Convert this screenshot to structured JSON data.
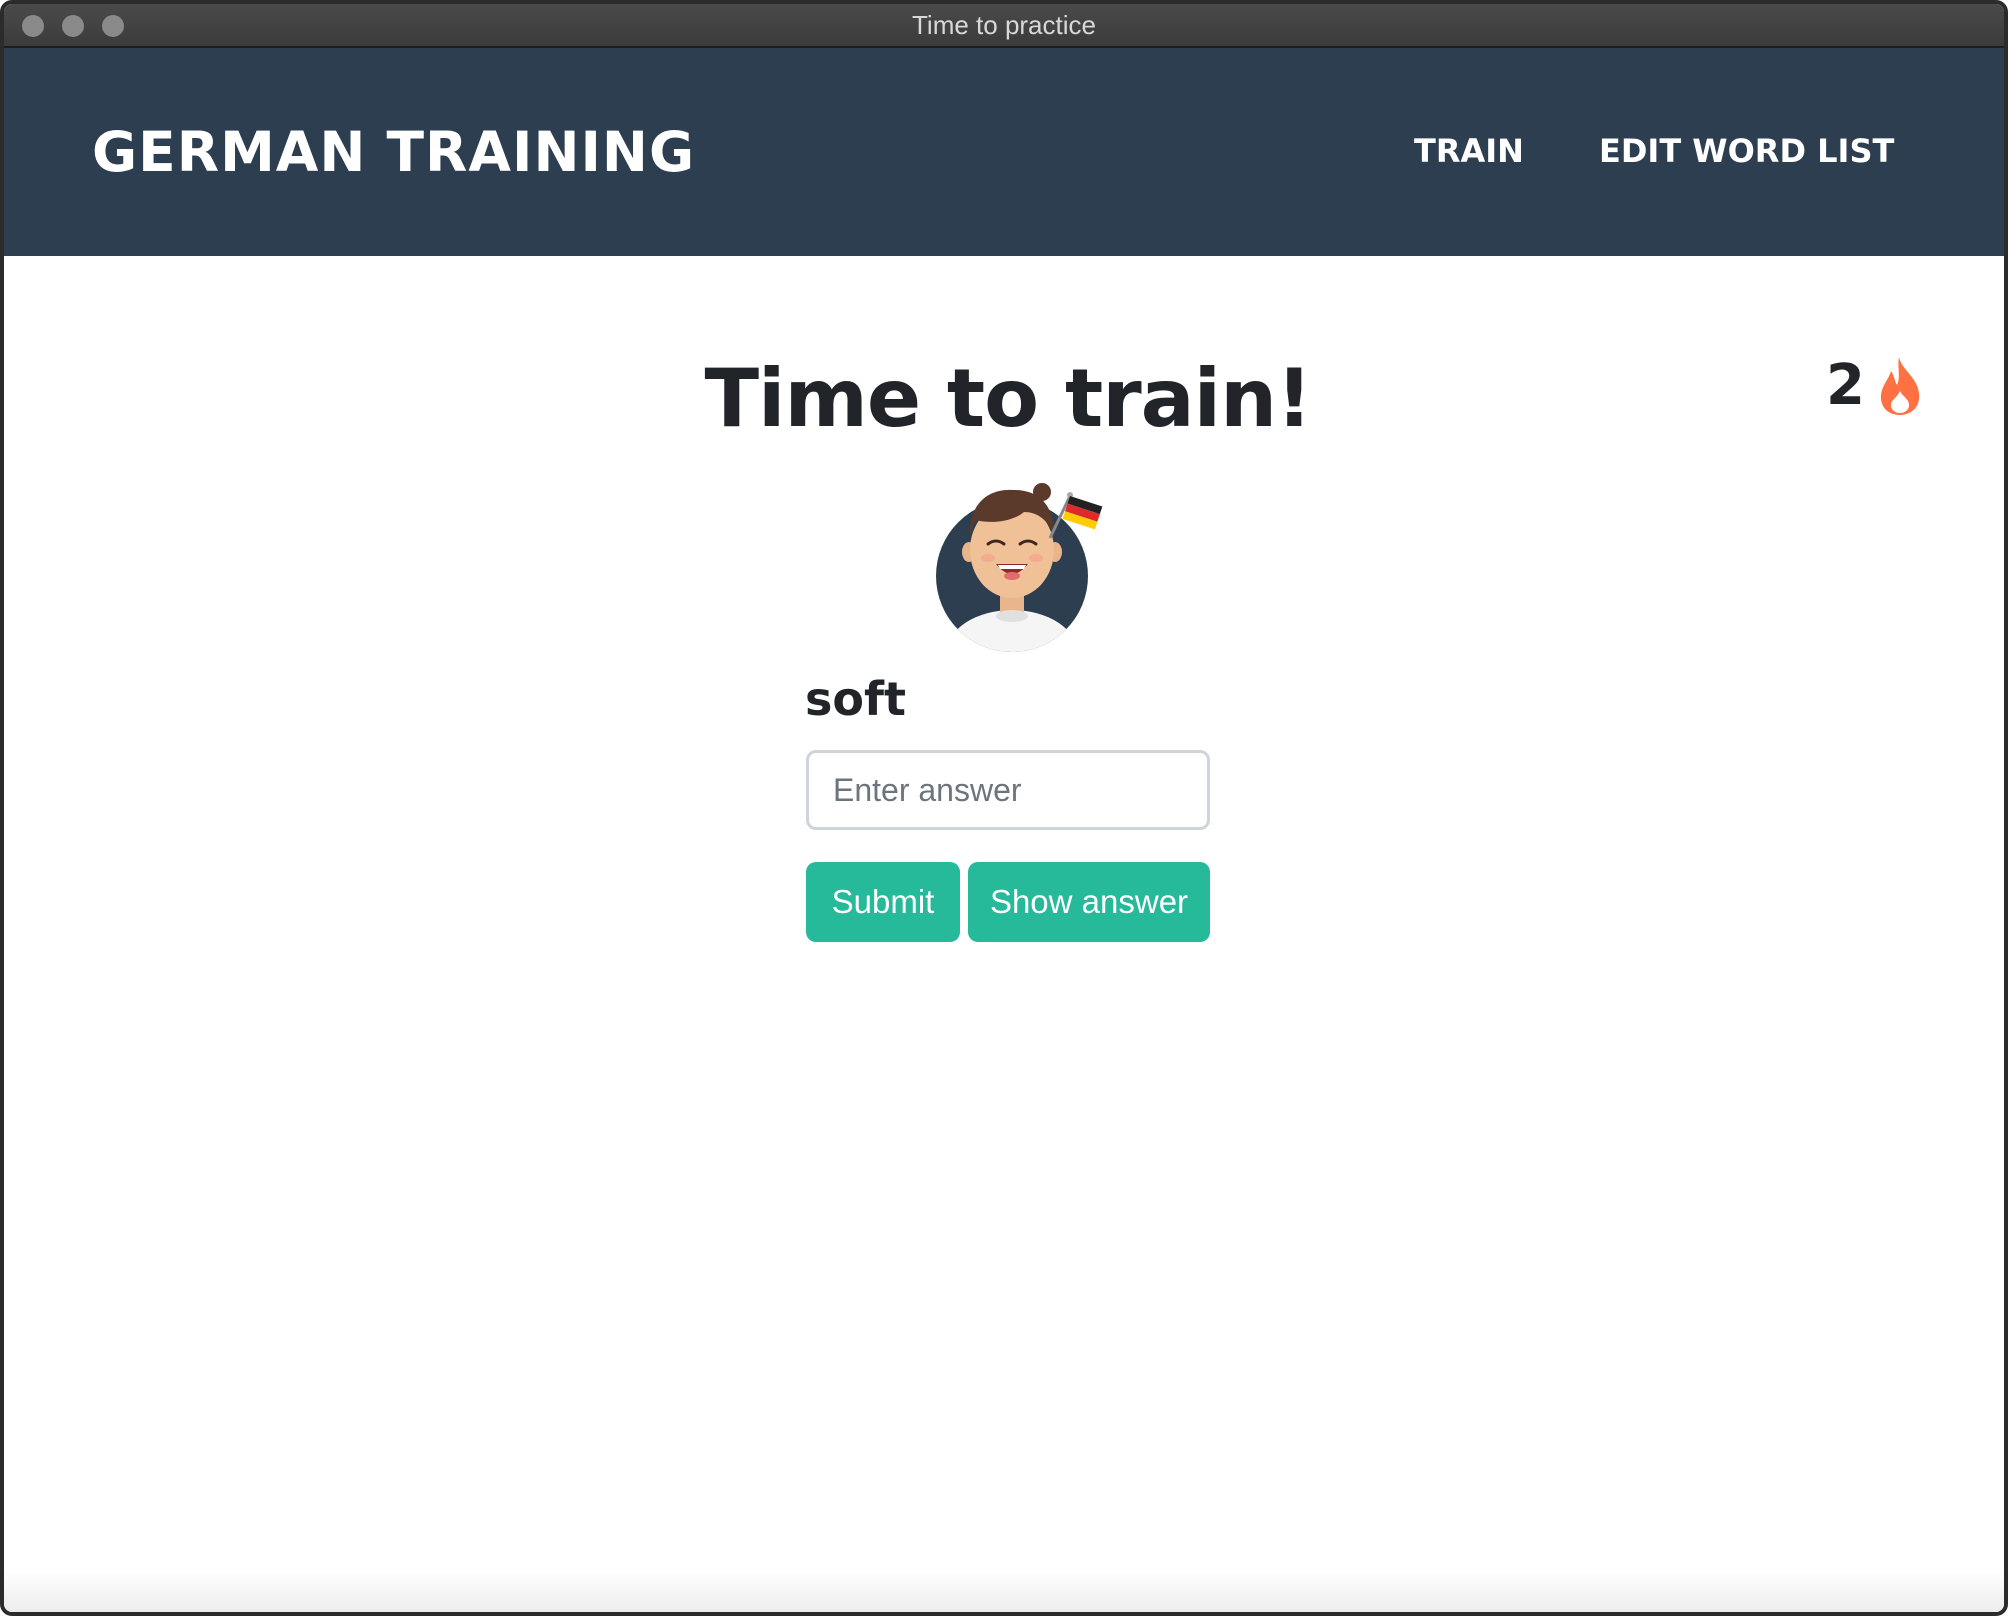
{
  "window": {
    "title": "Time to practice"
  },
  "navbar": {
    "brand": "GERMAN TRAINING",
    "links": [
      {
        "label": "TRAIN"
      },
      {
        "label": "EDIT WORD LIST"
      }
    ],
    "background_color": "#2e3e51"
  },
  "main": {
    "title": "Time to train!",
    "streak": {
      "count": "2",
      "icon": "fire-icon",
      "icon_color": "#ff7043"
    },
    "avatar": {
      "icon": "avatar-with-german-flag"
    },
    "prompt_word": "soft",
    "answer_input": {
      "value": "",
      "placeholder": "Enter answer"
    },
    "buttons": {
      "submit_label": "Submit",
      "show_answer_label": "Show answer",
      "color": "#26b99a"
    }
  }
}
